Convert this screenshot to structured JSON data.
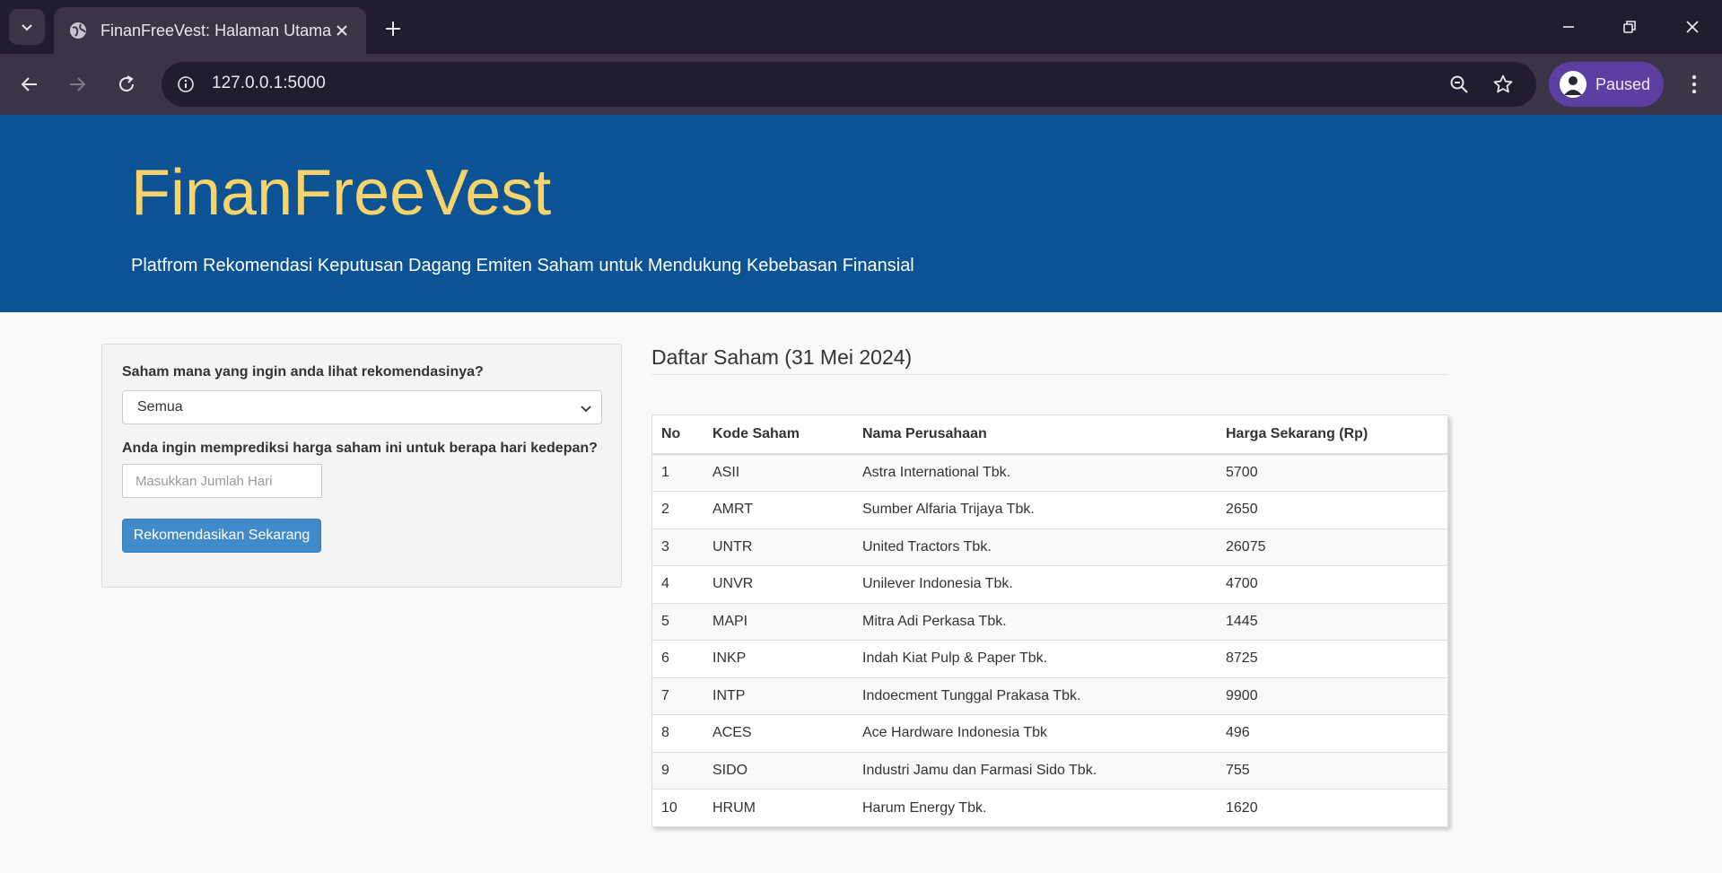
{
  "browser": {
    "tab_title": "FinanFreeVest: Halaman Utama",
    "url": "127.0.0.1:5000",
    "profile_label": "Paused"
  },
  "header": {
    "brand": "FinanFreeVest",
    "tagline": "Platfrom Rekomendasi Keputusan Dagang Emiten Saham untuk Mendukung Kebebasan Finansial",
    "background_color": "#0b5394",
    "brand_color": "#f6d36b"
  },
  "form": {
    "stock_question": "Saham mana yang ingin anda lihat rekomendasinya?",
    "stock_selected": "Semua",
    "days_question": "Anda ingin memprediksi harga saham ini untuk berapa hari kedepan?",
    "days_placeholder": "Masukkan Jumlah Hari",
    "days_value": "",
    "submit_label": "Rekomendasikan Sekarang",
    "button_color": "#428bca"
  },
  "stock_list": {
    "title": "Daftar Saham (31 Mei 2024)",
    "columns": [
      "No",
      "Kode Saham",
      "Nama Perusahaan",
      "Harga Sekarang (Rp)"
    ],
    "rows": [
      {
        "no": "1",
        "code": "ASII",
        "name": "Astra International Tbk.",
        "price": "5700"
      },
      {
        "no": "2",
        "code": "AMRT",
        "name": "Sumber Alfaria Trijaya Tbk.",
        "price": "2650"
      },
      {
        "no": "3",
        "code": "UNTR",
        "name": "United Tractors Tbk.",
        "price": "26075"
      },
      {
        "no": "4",
        "code": "UNVR",
        "name": "Unilever Indonesia Tbk.",
        "price": "4700"
      },
      {
        "no": "5",
        "code": "MAPI",
        "name": "Mitra Adi Perkasa Tbk.",
        "price": "1445"
      },
      {
        "no": "6",
        "code": "INKP",
        "name": "Indah Kiat Pulp & Paper Tbk.",
        "price": "8725"
      },
      {
        "no": "7",
        "code": "INTP",
        "name": "Indoecment Tunggal Prakasa Tbk.",
        "price": "9900"
      },
      {
        "no": "8",
        "code": "ACES",
        "name": "Ace Hardware Indonesia Tbk",
        "price": "496"
      },
      {
        "no": "9",
        "code": "SIDO",
        "name": "Industri Jamu dan Farmasi Sido Tbk.",
        "price": "755"
      },
      {
        "no": "10",
        "code": "HRUM",
        "name": "Harum Energy Tbk.",
        "price": "1620"
      }
    ]
  }
}
